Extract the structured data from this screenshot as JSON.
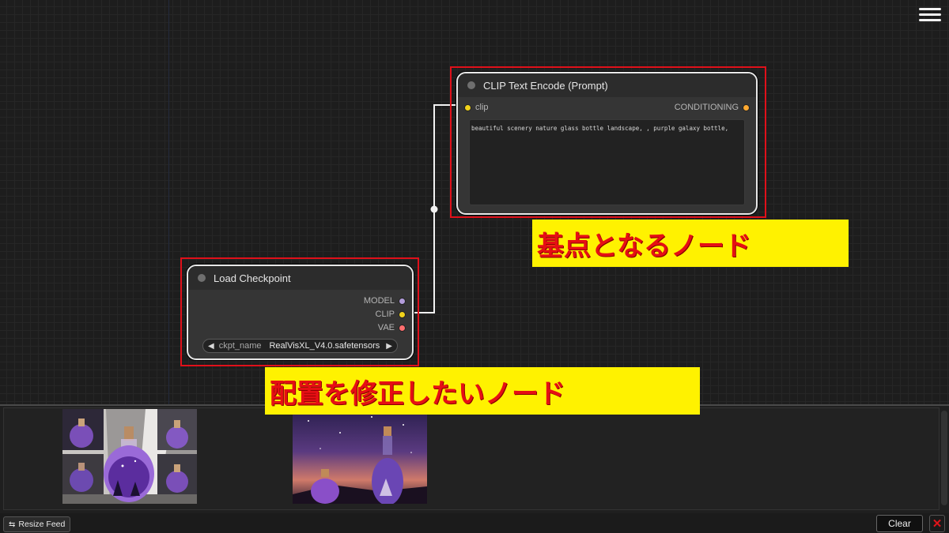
{
  "menu": {
    "icon": "hamburger-menu-icon"
  },
  "nodes": {
    "clip_text_encode": {
      "title": "CLIP Text Encode (Prompt)",
      "input_label": "clip",
      "output_label": "CONDITIONING",
      "prompt_text": "beautiful scenery nature glass bottle landscape, , purple galaxy bottle,"
    },
    "load_checkpoint": {
      "title": "Load Checkpoint",
      "outputs": [
        "MODEL",
        "CLIP",
        "VAE"
      ],
      "widget_name": "ckpt_name",
      "widget_value": "RealVisXL_V4.0.safetensors"
    }
  },
  "annotations": {
    "top": "基点となるノード",
    "bottom": "配置を修正したいノード"
  },
  "feed": {
    "images": [
      "purple-galaxy-bottle-grid-image",
      "purple-galaxy-bottle-landscape-image"
    ]
  },
  "bottom_bar": {
    "resize_feed_label": "Resize Feed",
    "clear_label": "Clear",
    "close_icon": "✕"
  },
  "colors": {
    "clip_slot": "#f2d31b",
    "conditioning_slot": "#ffa931",
    "model_slot": "#b39ddb",
    "vae_slot": "#ff6e6e",
    "annotation_bg": "#fff200",
    "annotation_text": "#e60f14"
  }
}
